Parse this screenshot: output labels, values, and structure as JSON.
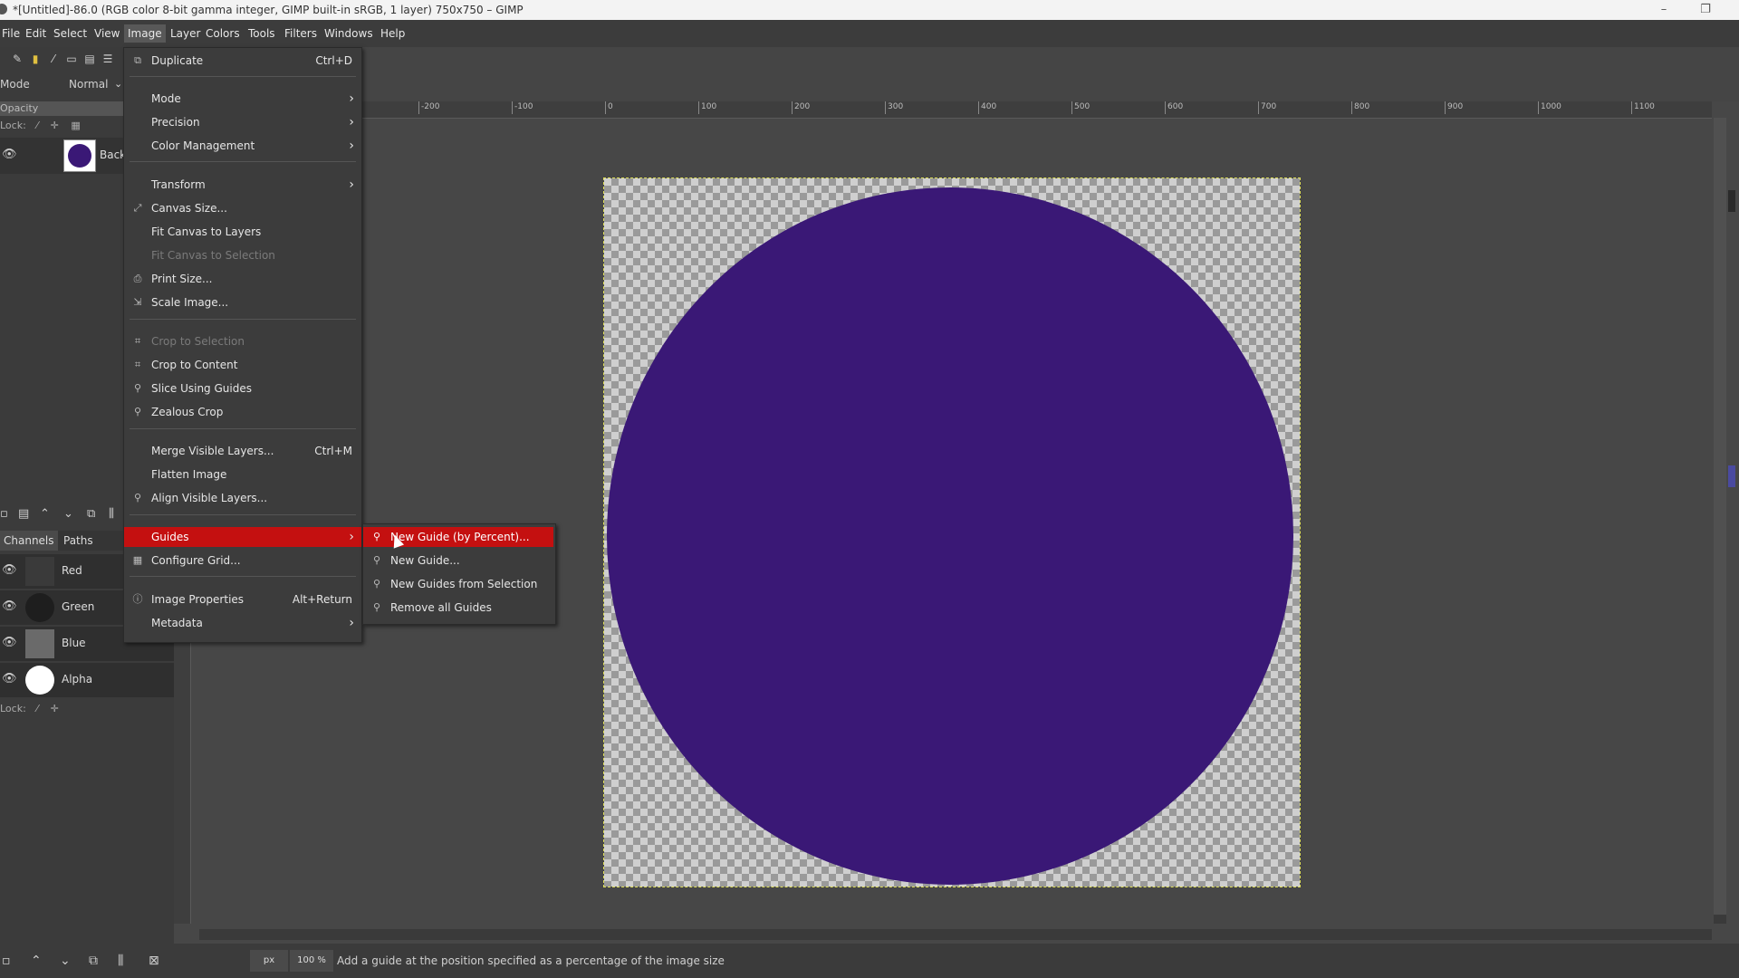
{
  "window": {
    "title": "*[Untitled]-86.0 (RGB color 8-bit gamma integer, GIMP built-in sRGB, 1 layer) 750x750 – GIMP",
    "minimize": "–",
    "restore": "❐"
  },
  "menubar": [
    "File",
    "Edit",
    "Select",
    "View",
    "Image",
    "Layer",
    "Colors",
    "Tools",
    "Filters",
    "Windows",
    "Help"
  ],
  "left_dock": {
    "mode_label": "Mode",
    "mode_value": "Normal",
    "opacity_label": "Opacity",
    "lock_label": "Lock:",
    "layer_name": "Back",
    "layer_color": "#3a1876",
    "tabs": [
      "Channels",
      "Paths"
    ],
    "channels": [
      {
        "name": "Red",
        "tile": "#3a3a3a"
      },
      {
        "name": "Green",
        "tile": "#1e1e1e"
      },
      {
        "name": "Blue",
        "tile": "#6a6a6a"
      },
      {
        "name": "Alpha",
        "tile": "#ffffff"
      }
    ],
    "lock_label2": "Lock:"
  },
  "image_menu": {
    "items": [
      {
        "label": "Duplicate",
        "shortcut": "Ctrl+D"
      },
      {
        "label": "Mode"
      },
      {
        "label": "Precision"
      },
      {
        "label": "Color Management"
      },
      {
        "label": "Transform"
      },
      {
        "label": "Canvas Size..."
      },
      {
        "label": "Fit Canvas to Layers"
      },
      {
        "label": "Fit Canvas to Selection"
      },
      {
        "label": "Print Size..."
      },
      {
        "label": "Scale Image..."
      },
      {
        "label": "Crop to Selection"
      },
      {
        "label": "Crop to Content"
      },
      {
        "label": "Slice Using Guides"
      },
      {
        "label": "Zealous Crop"
      },
      {
        "label": "Merge Visible Layers...",
        "shortcut": "Ctrl+M"
      },
      {
        "label": "Flatten Image"
      },
      {
        "label": "Align Visible Layers..."
      },
      {
        "label": "Guides"
      },
      {
        "label": "Configure Grid..."
      },
      {
        "label": "Image Properties",
        "shortcut": "Alt+Return"
      },
      {
        "label": "Metadata"
      }
    ]
  },
  "guides_submenu": {
    "items": [
      {
        "label": "New Guide (by Percent)..."
      },
      {
        "label": "New Guide..."
      },
      {
        "label": "New Guides from Selection"
      },
      {
        "label": "Remove all Guides"
      }
    ]
  },
  "ruler_labels": [
    "-200",
    "-100",
    "0",
    "100",
    "200",
    "300",
    "400",
    "500",
    "600",
    "700",
    "800",
    "900",
    "1000",
    "1100"
  ],
  "canvas": {
    "circle_color": "#3a1876"
  },
  "statusbar": {
    "unit": "px",
    "zoom": "100 %",
    "message": "Add a guide at the position specified as a percentage of the image size"
  },
  "colors": {
    "highlight": "#c41010"
  }
}
